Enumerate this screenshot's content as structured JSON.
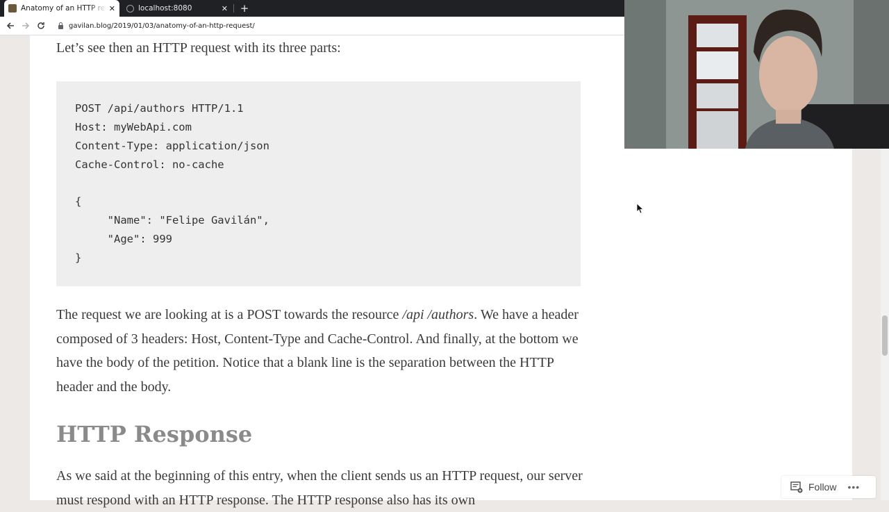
{
  "browser": {
    "tabs": [
      {
        "title": "Anatomy of an HTTP request",
        "active": true
      },
      {
        "title": "localhost:8080",
        "active": false
      }
    ],
    "new_tab": "+",
    "close_glyph": "✕",
    "address_bar": {
      "url": "gavilan.blog/2019/01/03/anatomy-of-an-http-request/"
    },
    "icons": {
      "back": "arrow-left",
      "forward": "arrow-right",
      "reload": "reload"
    }
  },
  "article": {
    "intro": "Let’s see then an HTTP request with its three parts:",
    "code_lines": [
      "POST /api/authors HTTP/1.1",
      "Host: myWebApi.com",
      "Content-Type: application/json",
      "Cache-Control: no-cache",
      "",
      "{",
      "     \"Name\": \"Felipe Gavilán\",",
      "     \"Age\": 999",
      "}"
    ],
    "paragraph": {
      "before": "The request we are looking at is a POST towards the resource ",
      "emphasis": "/api /authors",
      "after": ". We have a header composed of 3 headers: Host, Content-Type and Cache-Control. And finally, at the bottom we have the body of the petition. Notice that a blank line is the separation between the HTTP header and the body."
    },
    "heading": "HTTP Response",
    "paragraph2": "As we said at the beginning of this entry, when the client sends us an HTTP request, our server must respond with an HTTP response. The HTTP response also has its own"
  },
  "follow_bar": {
    "label": "Follow",
    "more": "•••"
  },
  "colors": {
    "tabbar": "#202124",
    "page_bg": "#ece9e6",
    "code_bg": "#eeeeee",
    "heading": "#8a8a8a",
    "text": "#3a3a3a"
  }
}
